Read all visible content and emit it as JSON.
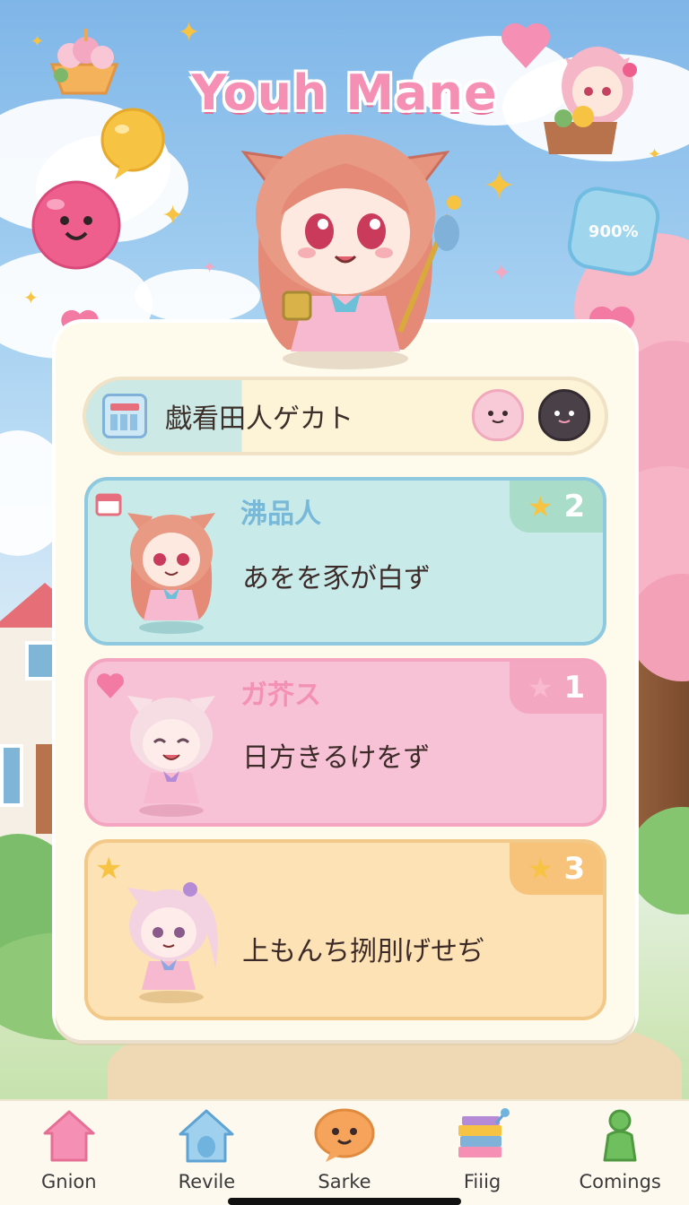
{
  "game": {
    "title": "Youh Mane"
  },
  "badge": {
    "text": "900%"
  },
  "status_bar": {
    "text": "戯看田人ゲカト",
    "icon": "calendar-icon"
  },
  "cards": [
    {
      "title": "沸品人",
      "body": "あをを豕が白ず",
      "rank": "2",
      "bg": "#c8ebea",
      "border": "#8fc9df",
      "title_color": "#78b8d8",
      "tab_color": "#a9dcc9",
      "corner_icon": "calendar-icon",
      "star_color": "#f6c343"
    },
    {
      "title": "ガ芥ス",
      "body": "日方きるけをず",
      "rank": "1",
      "bg": "#f8c2d6",
      "border": "#f4a6c0",
      "title_color": "#f391b3",
      "tab_color": "#f4a7c1",
      "corner_icon": "heart-icon",
      "star_color": "#f9b9cf"
    },
    {
      "title": "",
      "body": "上もんち挒刖げせぢ",
      "rank": "3",
      "bg": "#fce2b4",
      "border": "#f3c98a",
      "title_color": "#e9a957",
      "tab_color": "#f7c37a",
      "corner_icon": "star-icon",
      "star_color": "#f6c343"
    }
  ],
  "nav": [
    {
      "label": "Gnion",
      "icon": "home-icon"
    },
    {
      "label": "Revile",
      "icon": "house-icon"
    },
    {
      "label": "Sarke",
      "icon": "chat-bubble-icon"
    },
    {
      "label": "Fiiig",
      "icon": "books-icon"
    },
    {
      "label": "Comings",
      "icon": "pawn-icon"
    }
  ],
  "colors": {
    "title_pink": "#f58fb4",
    "panel_bg": "#fffbec",
    "nav_bg": "#fdf9ef"
  }
}
